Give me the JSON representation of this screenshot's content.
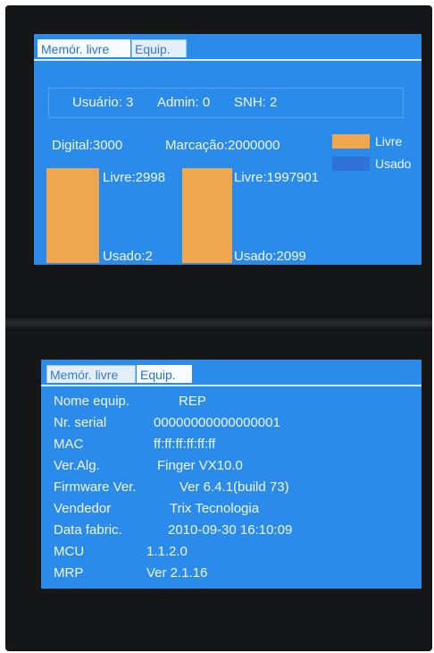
{
  "tabs": {
    "memory": "Memór. livre",
    "equipment": "Equip."
  },
  "memory_screen": {
    "users_label": "Usuário: 3",
    "admin_label": "Admin: 0",
    "snh_label": "SNH: 2",
    "digital_label": "Digital:3000",
    "marcacao_label": "Marcação:2000000",
    "legend": {
      "free_label": "Livre",
      "used_label": "Usado",
      "free_color": "#eea64f",
      "used_color": "#2f72d8"
    },
    "digital_bar": {
      "free_label": "Livre:2998",
      "used_label": "Usado:2",
      "free": 2998,
      "used": 2
    },
    "marcacao_bar": {
      "free_label": "Livre:1997901",
      "used_label": "Usado:2099",
      "free": 1997901,
      "used": 2099
    }
  },
  "equipment_screen": {
    "rows": [
      {
        "key": "Nome equip.",
        "value": "REP"
      },
      {
        "key": "Nr. serial",
        "value": "00000000000000001"
      },
      {
        "key": "MAC",
        "value": "ff:ff:ff:ff:ff:ff"
      },
      {
        "key": "Ver.Alg.",
        "value": "Finger VX10.0"
      },
      {
        "key": "Firmware Ver.",
        "value": "Ver 6.4.1(build 73)"
      },
      {
        "key": "Vendedor",
        "value": "Trix Tecnologia"
      },
      {
        "key": "Data fabric.",
        "value": "2010-09-30 16:10:09"
      },
      {
        "key": "MCU",
        "value": "1.1.2.0"
      },
      {
        "key": "MRP",
        "value": "Ver 2.1.16"
      }
    ]
  },
  "colors": {
    "screen_bg": "#2a8bea",
    "text": "#f2f7ff",
    "bar": "#eea64f"
  }
}
